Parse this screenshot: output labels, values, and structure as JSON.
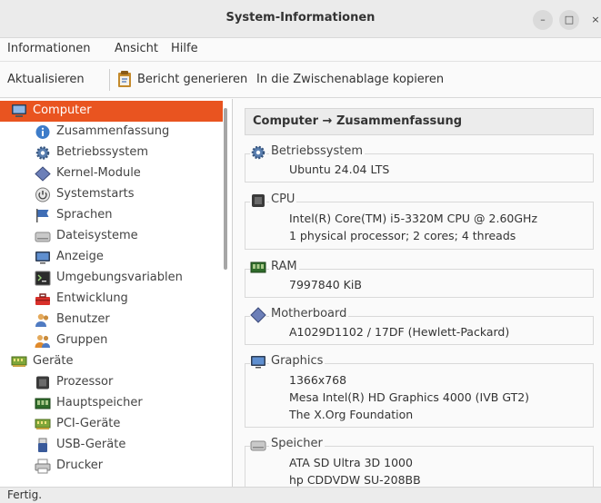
{
  "window": {
    "title": "System-Informationen",
    "minimize": "–",
    "maximize": "□",
    "close": "×"
  },
  "menu": [
    "Informationen",
    "Ansicht",
    "Hilfe"
  ],
  "toolbar": {
    "refresh": "Aktualisieren",
    "report": "Bericht generieren",
    "copy": "In die Zwischenablage kopieren"
  },
  "sidebar": {
    "items": [
      {
        "label": "Computer",
        "icon": "computer-icon"
      },
      {
        "label": "Zusammenfassung",
        "icon": "info-icon"
      },
      {
        "label": "Betriebssystem",
        "icon": "gear-icon"
      },
      {
        "label": "Kernel-Module",
        "icon": "kernel-icon"
      },
      {
        "label": "Systemstarts",
        "icon": "power-icon"
      },
      {
        "label": "Sprachen",
        "icon": "flag-icon"
      },
      {
        "label": "Dateisysteme",
        "icon": "drive-icon"
      },
      {
        "label": "Anzeige",
        "icon": "monitor-icon"
      },
      {
        "label": "Umgebungsvariablen",
        "icon": "terminal-icon"
      },
      {
        "label": "Entwicklung",
        "icon": "toolbox-icon"
      },
      {
        "label": "Benutzer",
        "icon": "users-icon"
      },
      {
        "label": "Gruppen",
        "icon": "group-icon"
      },
      {
        "label": "Geräte",
        "icon": "board-icon"
      },
      {
        "label": "Prozessor",
        "icon": "cpu-icon"
      },
      {
        "label": "Hauptspeicher",
        "icon": "ram-icon"
      },
      {
        "label": "PCI-Geräte",
        "icon": "pci-icon"
      },
      {
        "label": "USB-Geräte",
        "icon": "usb-icon"
      },
      {
        "label": "Drucker",
        "icon": "printer-icon"
      }
    ]
  },
  "main": {
    "header": "Computer → Zusammenfassung",
    "sections": [
      {
        "title": "Betriebssystem",
        "lines": [
          "Ubuntu 24.04 LTS"
        ]
      },
      {
        "title": "CPU",
        "lines": [
          "Intel(R) Core(TM) i5-3320M CPU @ 2.60GHz",
          "1 physical processor; 2 cores; 4 threads"
        ]
      },
      {
        "title": "RAM",
        "lines": [
          "7997840 KiB"
        ]
      },
      {
        "title": "Motherboard",
        "lines": [
          "A1029D1102 / 17DF (Hewlett-Packard)"
        ]
      },
      {
        "title": "Graphics",
        "lines": [
          "1366x768",
          "Mesa Intel(R) HD Graphics 4000 (IVB GT2)",
          "The X.Org Foundation"
        ]
      },
      {
        "title": "Speicher",
        "lines": [
          "ATA SD Ultra 3D 1000",
          "hp CDDVDW SU-208BB"
        ]
      }
    ]
  },
  "status": "Fertig.",
  "colors": {
    "selection": "#e95420"
  }
}
